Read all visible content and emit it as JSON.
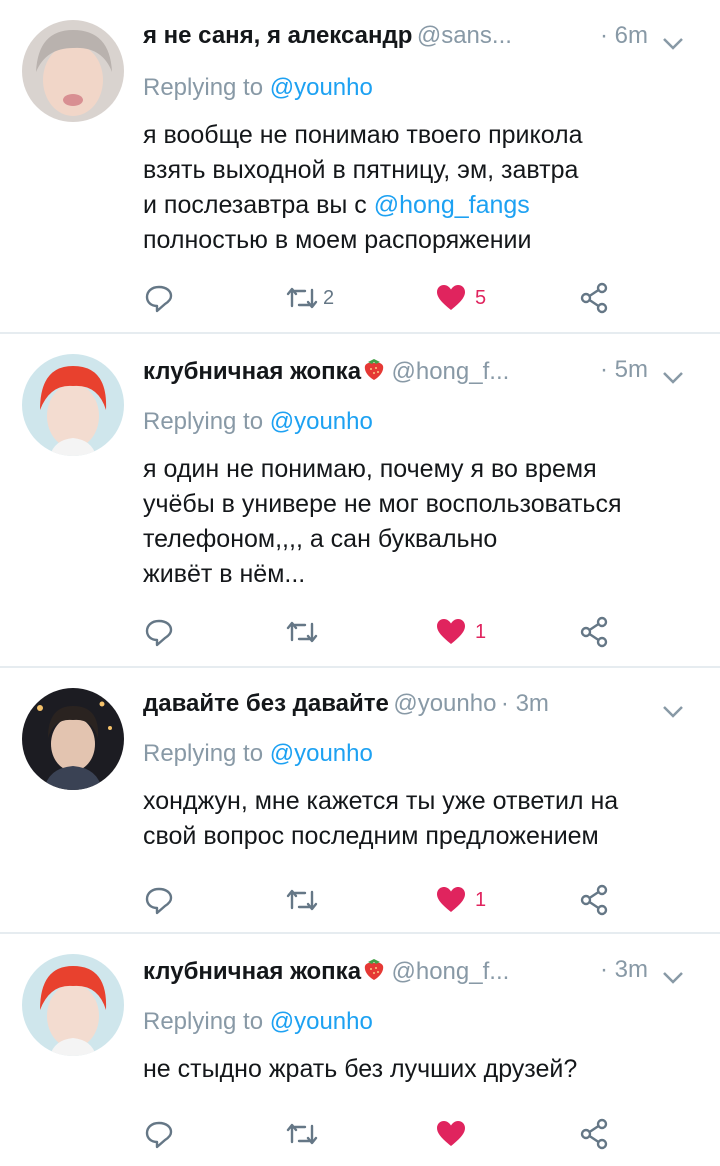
{
  "tweets": [
    {
      "name": "я не саня, я александр",
      "handle": "@sans...",
      "time": "· 6m",
      "replying_prefix": "Replying to",
      "replying_to": "@younho",
      "text_lines": [
        "я вообще не понимаю твоего прикола",
        "взять выходной в пятницу, эм, завтра",
        "и послезавтра вы с ",
        "полностью в моем распоряжении"
      ],
      "text_mention": "@hong_fangs",
      "retweets": "2",
      "likes": "5",
      "liked": true
    },
    {
      "name": "клубничная жопка",
      "name_emoji": "strawberry-icon",
      "handle": "@hong_f...",
      "time": "· 5m",
      "replying_prefix": "Replying to",
      "replying_to": "@younho",
      "text_lines": [
        "я один не понимаю, почему я во время",
        "учёбы в универе не мог воспользоваться",
        "телефоном,,,, а сан буквально",
        "живёт в нём..."
      ],
      "retweets": "",
      "likes": "1",
      "liked": true
    },
    {
      "name": "давайте без давайте",
      "handle": "@younho",
      "time": "· 3m",
      "replying_prefix": "Replying to",
      "replying_to": "@younho",
      "text_lines": [
        "хонджун, мне кажется ты уже ответил на",
        "свой вопрос последним предложением"
      ],
      "retweets": "",
      "likes": "1",
      "liked": true
    },
    {
      "name": "клубничная жопка",
      "name_emoji": "strawberry-icon",
      "handle": "@hong_f...",
      "time": "· 3m",
      "replying_prefix": "Replying to",
      "replying_to": "@younho",
      "text_lines": [
        "не стыдно жрать без лучших друзей?"
      ],
      "retweets": "",
      "likes": "",
      "liked": true
    }
  ],
  "colors": {
    "link": "#1da1f2",
    "muted": "#8899a6",
    "like": "#e0245e",
    "divider": "#e6ecf0"
  }
}
